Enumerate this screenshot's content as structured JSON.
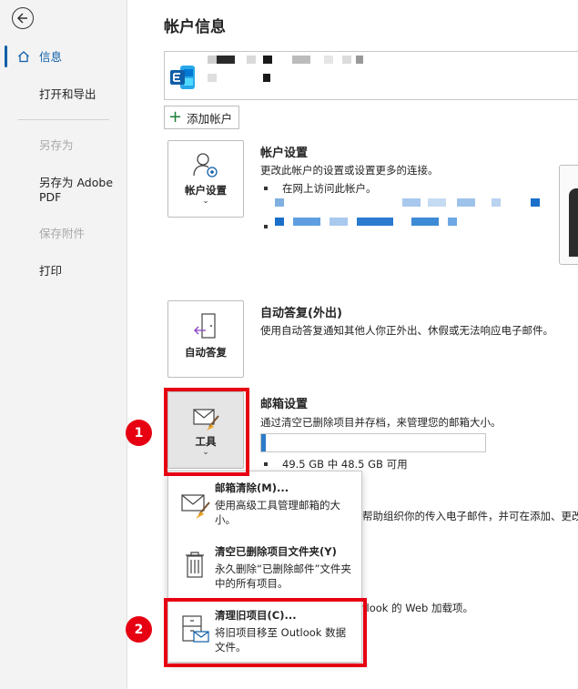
{
  "sidebar": {
    "items": [
      {
        "label": "信息"
      },
      {
        "label": "打开和导出"
      },
      {
        "label": "另存为"
      },
      {
        "label": "另存为 Adobe"
      },
      {
        "label": "PDF"
      },
      {
        "label": "保存附件"
      },
      {
        "label": "打印"
      }
    ]
  },
  "main": {
    "title": "帐户信息",
    "add_account": "添加帐户",
    "account_settings": {
      "tile_label": "帐户设置",
      "title": "帐户设置",
      "desc": "更改此帐户的设置或设置更多的连接。",
      "bullet": "在网上访问此帐户。"
    },
    "auto_reply": {
      "tile_label": "自动答复",
      "title": "自动答复(外出)",
      "desc": "使用自动答复通知其他人你正外出、休假或无法响应电子邮件。"
    },
    "mailbox": {
      "tile_label": "工具",
      "title": "邮箱设置",
      "desc": "通过清空已删除项目并存档，来管理您的邮箱大小。",
      "usage_text": "49.5 GB 中 48.5 GB 可用",
      "used_fraction": 0.02
    },
    "behind_text_1": "帮助组织你的传入电子邮件，并可在添加、更改",
    "behind_text_2": "tlook 的 Web 加载项。"
  },
  "tools_menu": {
    "items": [
      {
        "title": "邮箱清除(M)...",
        "desc": "使用高级工具管理邮箱的大小。"
      },
      {
        "title": "清空已删除项目文件夹(Y)",
        "desc": "永久删除“已删除邮件”文件夹中的所有项目。"
      },
      {
        "title": "清理旧项目(C)...",
        "desc": "将旧项目移至 Outlook 数据文件。"
      }
    ]
  },
  "annotations": {
    "badge1": "1",
    "badge2": "2",
    "color": "#e60012"
  },
  "colors": {
    "accent": "#0f5ea8",
    "progress": "#2b7cc8"
  }
}
